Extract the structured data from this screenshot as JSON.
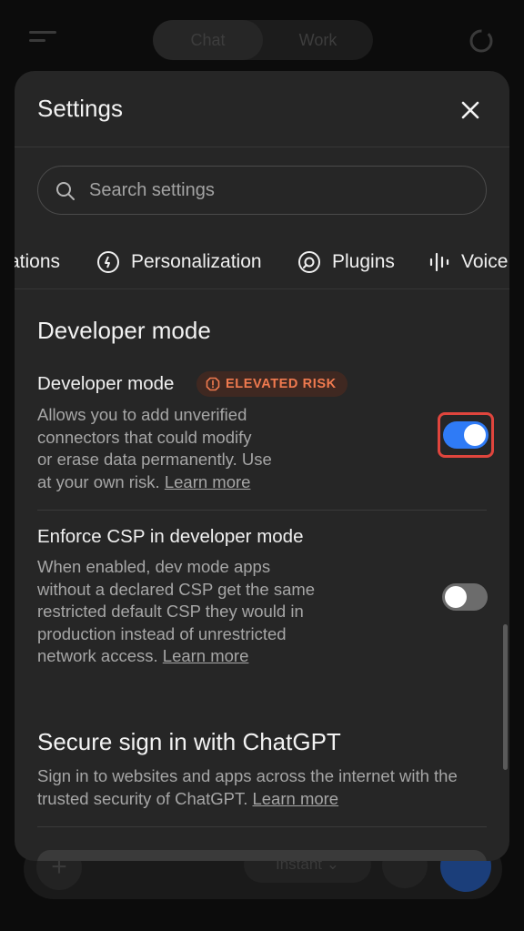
{
  "background": {
    "segment": [
      "Chat",
      "Work"
    ],
    "model_label": "Instant ⌄"
  },
  "settings": {
    "title": "Settings",
    "search_placeholder": "Search settings",
    "tabs": [
      {
        "label": "ations",
        "icon": "bell-icon"
      },
      {
        "label": "Personalization",
        "icon": "personalization-icon"
      },
      {
        "label": "Plugins",
        "icon": "plugins-icon"
      },
      {
        "label": "Voice",
        "icon": "voice-waveform-icon"
      }
    ],
    "developer_section": {
      "heading": "Developer mode",
      "developer_mode": {
        "title": "Developer mode",
        "badge": "ELEVATED RISK",
        "desc_lines": [
          "Allows you to add unverified",
          "connectors that could modify",
          "or erase data permanently. Use",
          "at your own risk."
        ],
        "link": "Learn more",
        "enabled": true
      },
      "enforce_csp": {
        "title": "Enforce CSP in developer mode",
        "desc_lines": [
          "When enabled, dev mode apps",
          "without a declared CSP get the same",
          "restricted default CSP they would in",
          "production instead of unrestricted",
          "network access."
        ],
        "link": "Learn more",
        "enabled": false
      }
    },
    "secure_signin": {
      "heading": "Secure sign in with ChatGPT",
      "desc_lines": [
        "Sign in to websites and apps across the internet with the",
        "trusted security of ChatGPT."
      ],
      "link": "Learn more"
    }
  },
  "colors": {
    "accent": "#2f7bf6",
    "badge_text": "#f07a4f",
    "highlight": "#e0453d"
  }
}
